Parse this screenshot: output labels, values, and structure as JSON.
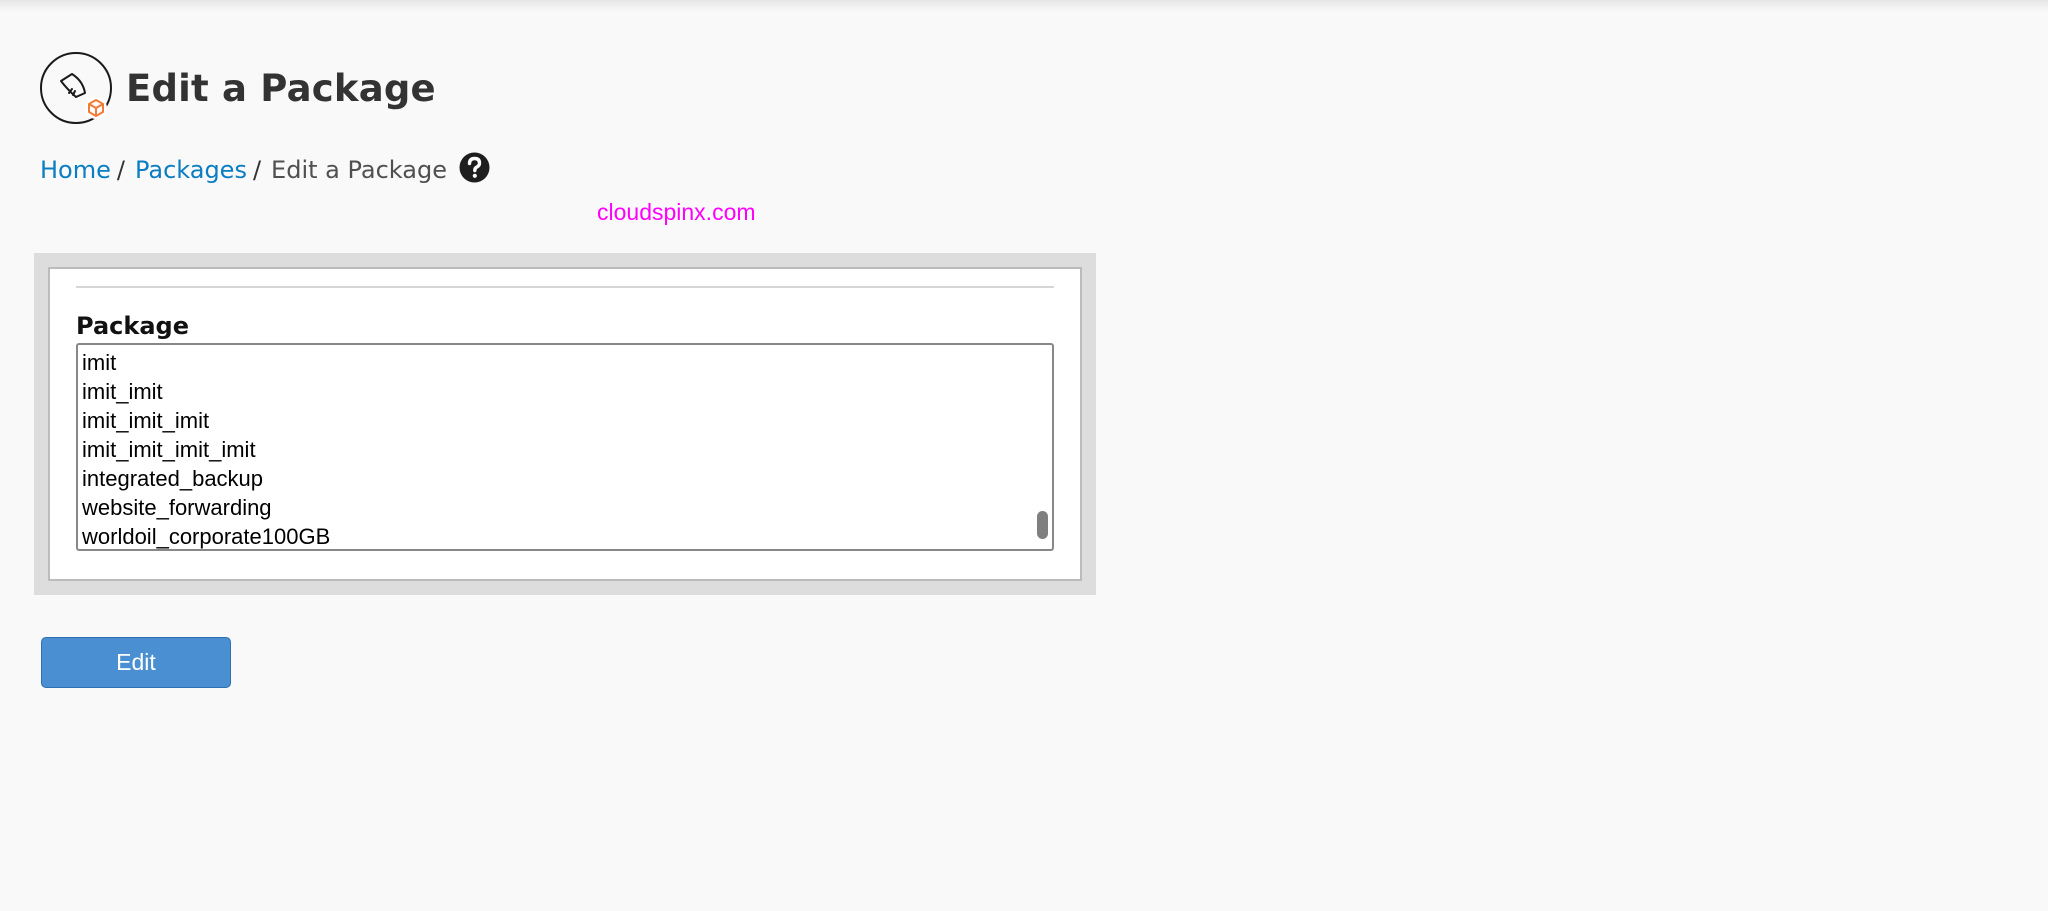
{
  "page": {
    "title": "Edit a Package",
    "icon": "package-rocket-icon"
  },
  "breadcrumb": {
    "items": [
      {
        "label": "Home"
      },
      {
        "label": "Packages"
      }
    ],
    "separator": "/",
    "current": "Edit a Package",
    "help_icon": "question-circle-icon"
  },
  "watermark": "cloudspinx.com",
  "form": {
    "package_label": "Package",
    "package_options": [
      "imit",
      "imit_imit",
      "imit_imit_imit",
      "imit_imit_imit_imit",
      "integrated_backup",
      "website_forwarding",
      "worldoil_corporate100GB"
    ],
    "submit_label": "Edit"
  },
  "colors": {
    "link": "#0b7dc1",
    "button": "#4a8fd2",
    "watermark": "#ff00ff",
    "icon_accent": "#f47b35"
  }
}
